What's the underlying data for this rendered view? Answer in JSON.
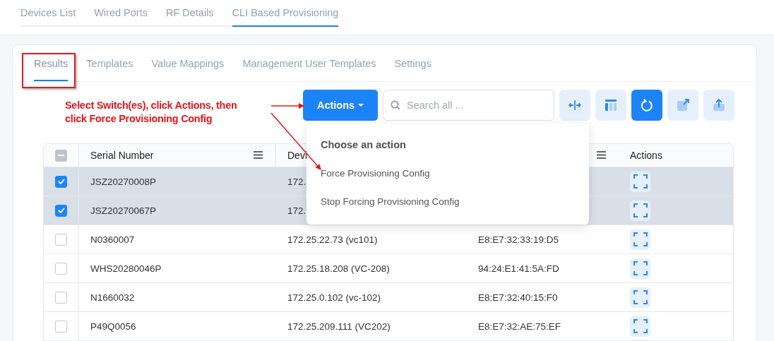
{
  "top_tabs": [
    {
      "label": "Devices List",
      "selected": false
    },
    {
      "label": "Wired Ports",
      "selected": false
    },
    {
      "label": "RF Details",
      "selected": false
    },
    {
      "label": "CLI Based Provisioning",
      "selected": true
    }
  ],
  "sub_tabs": [
    {
      "label": "Results",
      "selected": true
    },
    {
      "label": "Templates",
      "selected": false
    },
    {
      "label": "Value Mappings",
      "selected": false
    },
    {
      "label": "Management User Templates",
      "selected": false
    },
    {
      "label": "Settings",
      "selected": false
    }
  ],
  "annotation": {
    "text": "Select Switch(es), click Actions, then\nclick Force Provisioning Config"
  },
  "toolbar": {
    "actions_button": "Actions",
    "search": {
      "placeholder": "Search all ..."
    },
    "icon_buttons": [
      {
        "kind": "resize",
        "active": false
      },
      {
        "kind": "columns",
        "active": false
      },
      {
        "kind": "refresh",
        "active": true
      },
      {
        "kind": "export",
        "active": false
      },
      {
        "kind": "upload",
        "active": false
      }
    ]
  },
  "dropdown": {
    "title": "Choose an action",
    "items": [
      "Force Provisioning Config",
      "Stop Forcing Provisioning Config"
    ]
  },
  "table": {
    "select_all_indeterminate": true,
    "columns": [
      {
        "label": "Serial Number",
        "menu": true
      },
      {
        "label": "Devi",
        "menu": false
      },
      {
        "menu": true
      },
      {
        "label": "Actions",
        "menu": false
      }
    ],
    "rows": [
      {
        "selected": true,
        "serial_number": "JSZ20270008P",
        "column_2": "172."
      },
      {
        "selected": true,
        "serial_number": "JSZ20270067P",
        "column_2": "172."
      },
      {
        "selected": false,
        "serial_number": "N0360007",
        "column_2": "172.25.22.73 (vc101)",
        "column_3": "E8:E7:32:33:19:D5"
      },
      {
        "selected": false,
        "serial_number": "WHS20280046P",
        "column_2": "172.25.18.208 (VC-208)",
        "column_3": "94:24:E1:41:5A:FD"
      },
      {
        "selected": false,
        "serial_number": "N1660032",
        "column_2": "172.25.0.102 (vc-102)",
        "column_3": "E8:E7:32:40:15:F0"
      },
      {
        "selected": false,
        "serial_number": "P49Q0056",
        "column_2": "172.25.209.111 (VC202)",
        "column_3": "E8:E7:32:AE:75:EF"
      }
    ]
  }
}
